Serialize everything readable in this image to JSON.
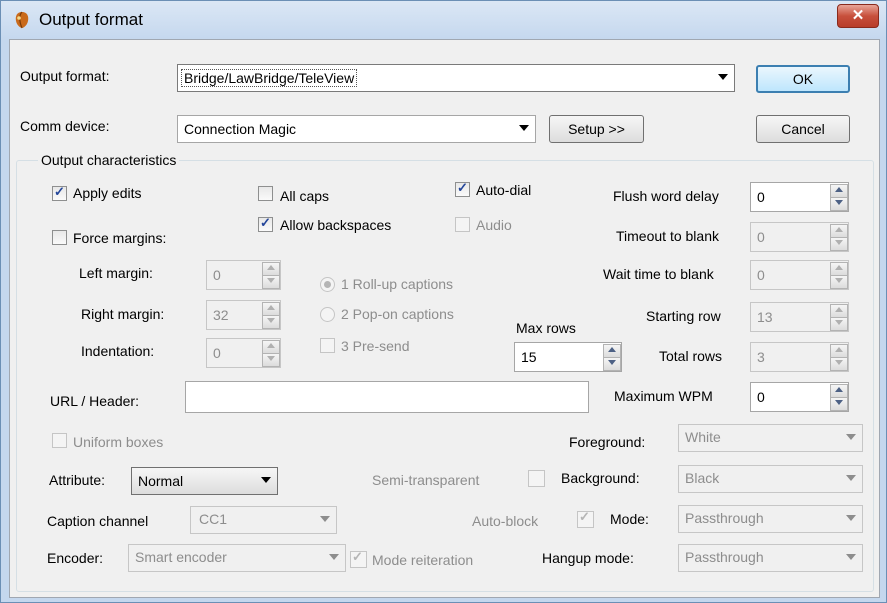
{
  "window": {
    "title": "Output format",
    "close_glyph": "✕"
  },
  "output_format": {
    "label": "Output format:",
    "value": "Bridge/LawBridge/TeleView"
  },
  "comm_device": {
    "label": "Comm device:",
    "value": "Connection Magic",
    "setup_label": "Setup >>"
  },
  "buttons": {
    "ok": "OK",
    "cancel": "Cancel"
  },
  "characteristics": {
    "group_title": "Output characteristics",
    "apply_edits": {
      "label": "Apply edits",
      "checked": true
    },
    "all_caps": {
      "label": "All caps",
      "checked": false
    },
    "auto_dial": {
      "label": "Auto-dial",
      "checked": true
    },
    "allow_backspaces": {
      "label": "Allow backspaces",
      "checked": true
    },
    "audio": {
      "label": "Audio",
      "checked": false,
      "enabled": false
    },
    "force_margins": {
      "label": "Force margins:",
      "checked": false
    },
    "left_margin": {
      "label": "Left margin:",
      "value": "0"
    },
    "right_margin": {
      "label": "Right margin:",
      "value": "32"
    },
    "indentation": {
      "label": "Indentation:",
      "value": "0"
    },
    "roll_up": {
      "label": "1 Roll-up captions",
      "selected": true
    },
    "pop_on": {
      "label": "2 Pop-on captions",
      "selected": false
    },
    "pre_send": {
      "label": "3 Pre-send",
      "checked": false
    },
    "max_rows": {
      "label": "Max rows",
      "value": "15"
    },
    "flush_word_delay": {
      "label": "Flush word delay",
      "value": "0"
    },
    "timeout_to_blank": {
      "label": "Timeout to blank",
      "value": "0"
    },
    "wait_time_to_blank": {
      "label": "Wait time to blank",
      "value": "0"
    },
    "starting_row": {
      "label": "Starting row",
      "value": "13"
    },
    "total_rows": {
      "label": "Total rows",
      "value": "3"
    },
    "url_header": {
      "label": "URL / Header:",
      "value": ""
    },
    "maximum_wpm": {
      "label": "Maximum WPM",
      "value": "0"
    },
    "uniform_boxes": {
      "label": "Uniform boxes",
      "checked": false
    },
    "foreground": {
      "label": "Foreground:",
      "value": "White"
    },
    "attribute": {
      "label": "Attribute:",
      "value": "Normal"
    },
    "semi_transparent": {
      "label": "Semi-transparent",
      "checked": false
    },
    "background": {
      "label": "Background:",
      "value": "Black"
    },
    "caption_channel": {
      "label": "Caption channel",
      "value": "CC1"
    },
    "auto_block": {
      "label": "Auto-block",
      "checked": true
    },
    "mode": {
      "label": "Mode:",
      "value": "Passthrough"
    },
    "encoder": {
      "label": "Encoder:",
      "value": "Smart encoder"
    },
    "mode_reiteration": {
      "label": "Mode reiteration",
      "checked": true
    },
    "hangup_mode": {
      "label": "Hangup mode:",
      "value": "Passthrough"
    }
  }
}
